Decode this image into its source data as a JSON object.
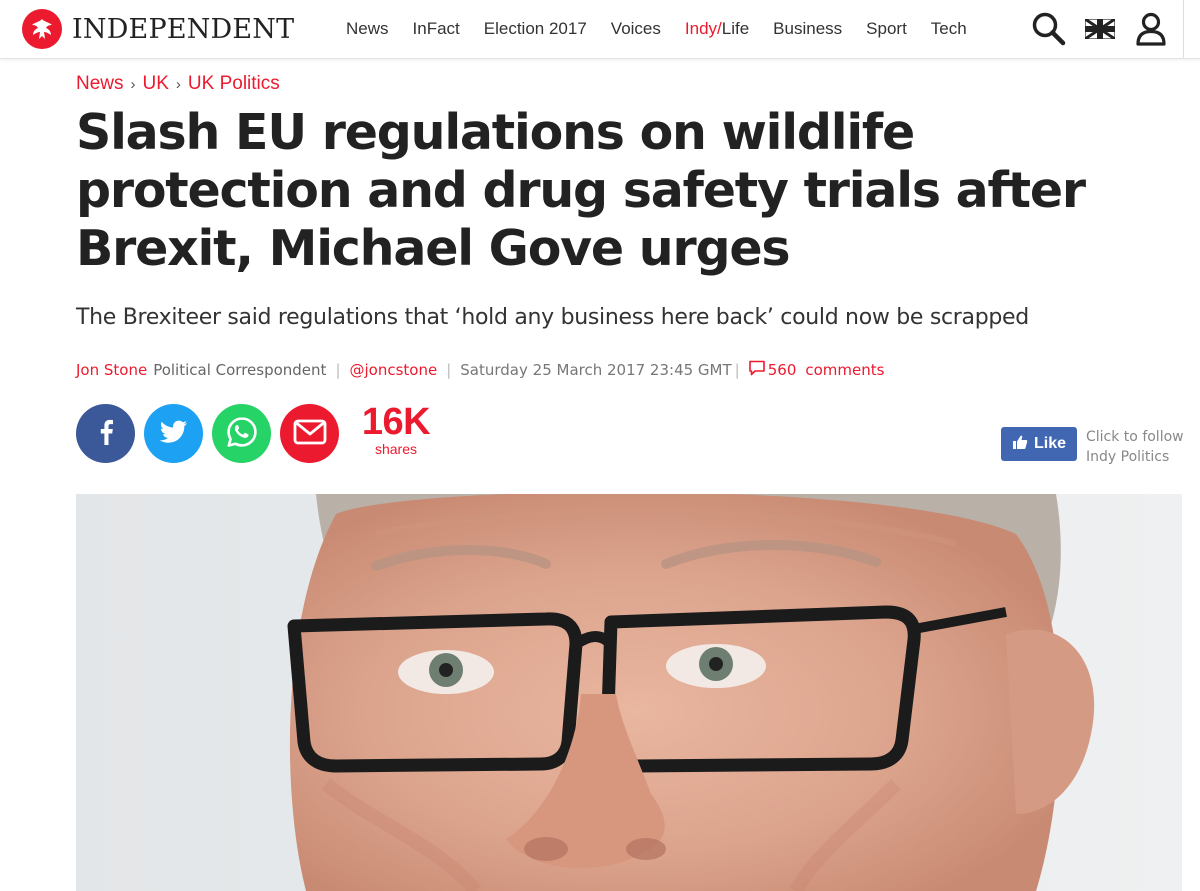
{
  "site": {
    "logo_text": "INDEPENDENT",
    "accent_color": "#ec1a2e"
  },
  "nav": {
    "items": [
      {
        "label": "News"
      },
      {
        "label": "InFact"
      },
      {
        "label": "Election 2017"
      },
      {
        "label": "Voices"
      },
      {
        "label_part1": "Indy/",
        "label_part2": "Life"
      },
      {
        "label": "Business"
      },
      {
        "label": "Sport"
      },
      {
        "label": "Tech"
      }
    ]
  },
  "header_tools": {
    "search_icon": "search-icon",
    "edition_icon": "uk-flag-icon",
    "account_icon": "user-icon"
  },
  "article": {
    "breadcrumb": [
      "News",
      "UK",
      "UK Politics"
    ],
    "breadcrumb_separator": "›",
    "headline": "Slash EU regulations on wildlife protection and drug safety trials after Brexit, Michael Gove urges",
    "standfirst": "The Brexiteer said regulations that ‘hold any business here back’ could now be scrapped",
    "byline": {
      "author": "Jon Stone",
      "role": "Political Correspondent",
      "separator": "|",
      "handle": "@joncstone",
      "date": "Saturday 25 March 2017 23:45 GMT",
      "comment_count": "560",
      "comments_label": "comments"
    }
  },
  "share": {
    "buttons": [
      "facebook-icon",
      "twitter-icon",
      "whatsapp-icon",
      "email-icon"
    ],
    "count": "16K",
    "count_label": "shares"
  },
  "follow": {
    "like_label": "Like",
    "text_line1": "Click to follow",
    "text_line2": "Indy Politics"
  },
  "colors": {
    "facebook": "#3b5998",
    "twitter": "#1da1f2",
    "whatsapp": "#25d366",
    "email": "#ec1a2e",
    "like_button": "#4267b2"
  }
}
